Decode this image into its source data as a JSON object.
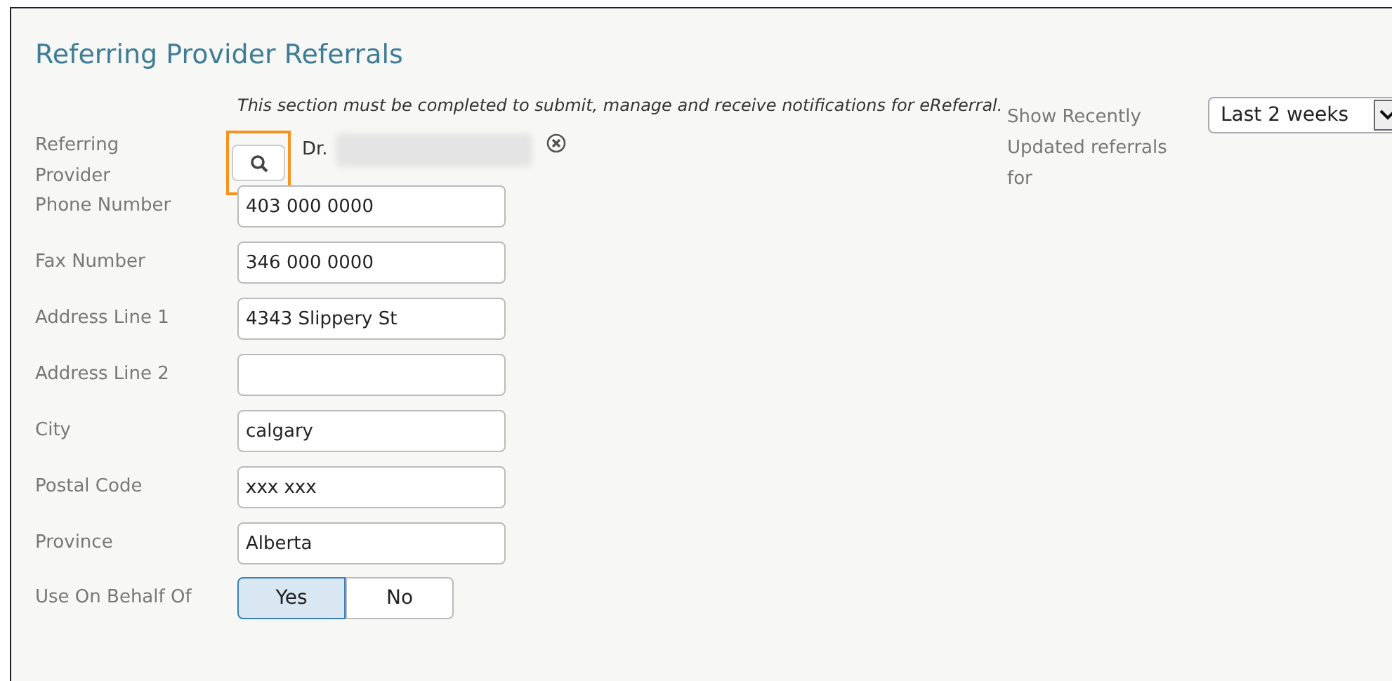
{
  "title": "Referring Provider Referrals",
  "notice": "This section must be completed to submit, manage and receive notifications for eReferral.",
  "referring_provider": {
    "label": "Referring Provider",
    "value": "Dr."
  },
  "fields": [
    {
      "label": "Phone Number",
      "value": "403 000 0000"
    },
    {
      "label": "Fax Number",
      "value": "346 000 0000"
    },
    {
      "label": "Address Line 1",
      "value": "4343 Slippery St"
    },
    {
      "label": "Address Line 2"
    },
    {
      "label": "City",
      "value": "calgary"
    },
    {
      "label": "Postal Code",
      "value": "xxx xxx"
    },
    {
      "label": "Province",
      "value": "Alberta"
    }
  ],
  "on_behalf": {
    "label": "Use On Behalf Of",
    "options": [
      {
        "label": "Yes",
        "selected": true
      },
      {
        "label": "No",
        "selected": false
      }
    ]
  },
  "recent": {
    "label": "Show Recently Updated referrals for",
    "value": "Last 2 weeks"
  }
}
